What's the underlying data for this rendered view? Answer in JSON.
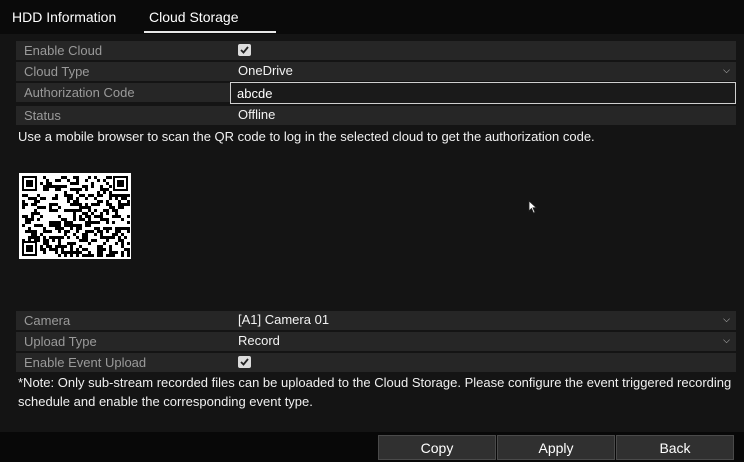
{
  "tabs": {
    "hdd_information": "HDD Information",
    "cloud_storage": "Cloud Storage"
  },
  "cloud": {
    "enable_label": "Enable Cloud",
    "enable_checked": true,
    "type_label": "Cloud Type",
    "type_value": "OneDrive",
    "auth_label": "Authorization Code",
    "auth_value": "abcde",
    "status_label": "Status",
    "status_value": "Offline"
  },
  "hint_text": "Use a mobile browser to scan the QR code to log in the selected cloud to get the authorization code.",
  "upload": {
    "camera_label": "Camera",
    "camera_value": "[A1] Camera 01",
    "upload_type_label": "Upload Type",
    "upload_type_value": "Record",
    "event_upload_label": "Enable Event Upload",
    "event_upload_checked": true
  },
  "note_text": "*Note: Only sub-stream recorded files can be uploaded to the Cloud Storage. Please configure the event triggered recording schedule and enable the corresponding event type.",
  "buttons": {
    "copy": "Copy",
    "apply": "Apply",
    "back": "Back"
  },
  "icons": {
    "checkbox": "checkbox-checked-icon",
    "dropdown": "chevron-down-icon",
    "qr": "qr-code-icon",
    "cursor": "mouse-pointer-icon"
  }
}
